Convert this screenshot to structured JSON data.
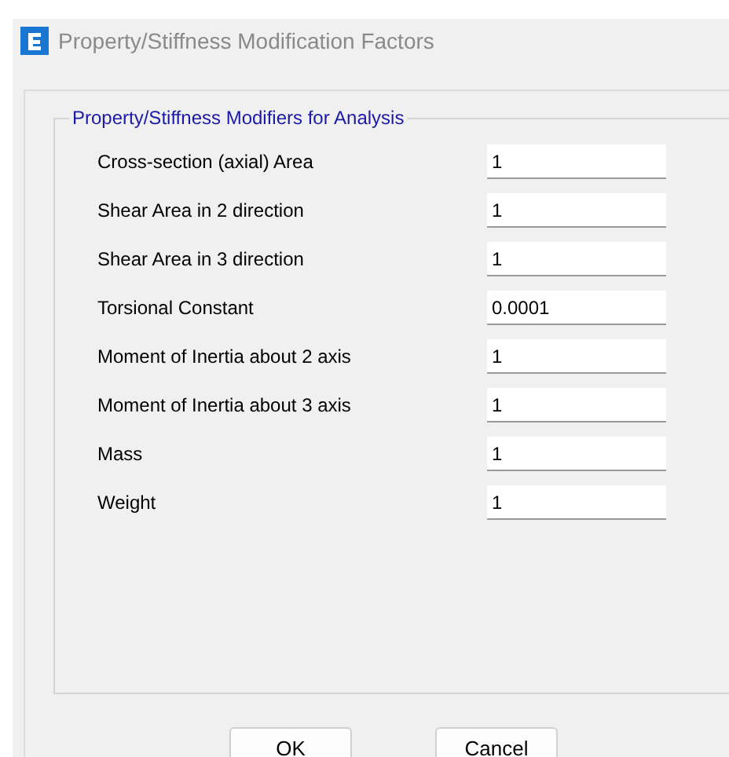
{
  "window": {
    "title": "Property/Stiffness Modification Factors"
  },
  "group": {
    "title": "Property/Stiffness Modifiers for Analysis",
    "fields": [
      {
        "label": "Cross-section (axial) Area",
        "value": "1"
      },
      {
        "label": "Shear Area in 2 direction",
        "value": "1"
      },
      {
        "label": "Shear Area in 3 direction",
        "value": "1"
      },
      {
        "label": "Torsional Constant",
        "value": "0.0001"
      },
      {
        "label": "Moment of Inertia about 2 axis",
        "value": "1"
      },
      {
        "label": "Moment of Inertia about 3 axis",
        "value": "1"
      },
      {
        "label": "Mass",
        "value": "1"
      },
      {
        "label": "Weight",
        "value": "1"
      }
    ]
  },
  "buttons": [
    "OK",
    "Cancel"
  ]
}
